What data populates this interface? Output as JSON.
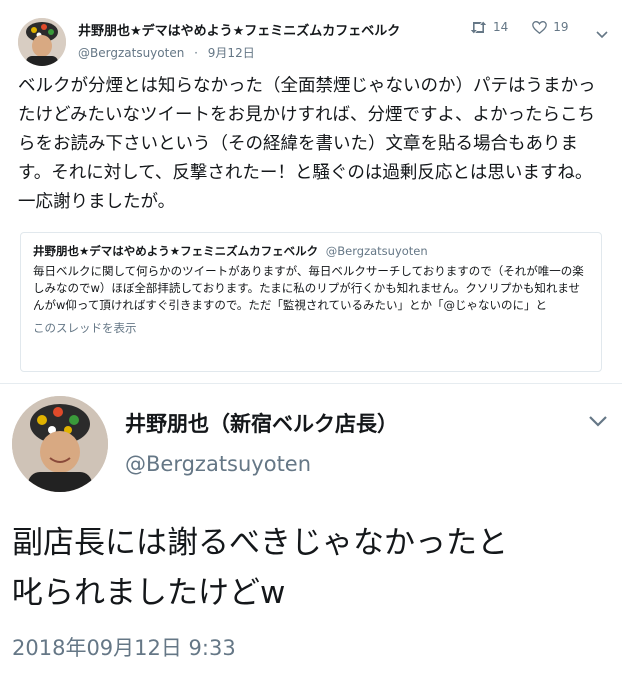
{
  "top_tweet": {
    "display_name": "井野朋也★デマはやめよう★フェミニズムカフェベルク",
    "handle": "@Bergzatsuyoten",
    "date": "9月12日",
    "retweet_count": "14",
    "like_count": "19",
    "text": "ベルクが分煙とは知らなかった（全面禁煙じゃないのか）パテはうまかったけどみたいなツイートをお見かけすれば、分煙ですよ、よかったらこちらをお読み下さいという（その経緯を書いた）文章を貼る場合もあります。それに対して、反撃されたー！と騒ぐのは過剰反応とは思いますね。一応謝りましたが。",
    "quoted": {
      "display_name": "井野朋也★デマはやめよう★フェミニズムカフェベルク",
      "handle": "@Bergzatsuyoten",
      "text": "毎日ベルクに関して何らかのツイートがありますが、毎日ベルクサーチしておりますので（それが唯一の楽しみなのでw）ほぼ全部拝読しております。たまに私のリプが行くかも知れません。クソリプかも知れませんがw仰って頂ければすぐ引きますので。ただ「監視されているみたい」とか「@じゃないのに」と",
      "show_thread": "このスレッドを表示"
    },
    "icons": [
      "retweet-icon",
      "heart-icon",
      "chevron-down-icon"
    ],
    "colors": {
      "secondary_text": "#657786",
      "border": "#e1e8ed"
    }
  },
  "bottom_tweet": {
    "display_name": "井野朋也（新宿ベルク店長）",
    "handle": "@Bergzatsuyoten",
    "text_line1": "副店長には謝るべきじゃなかったと",
    "text_line2": "叱られましたけどw",
    "timestamp": "2018年09月12日 9:33"
  }
}
